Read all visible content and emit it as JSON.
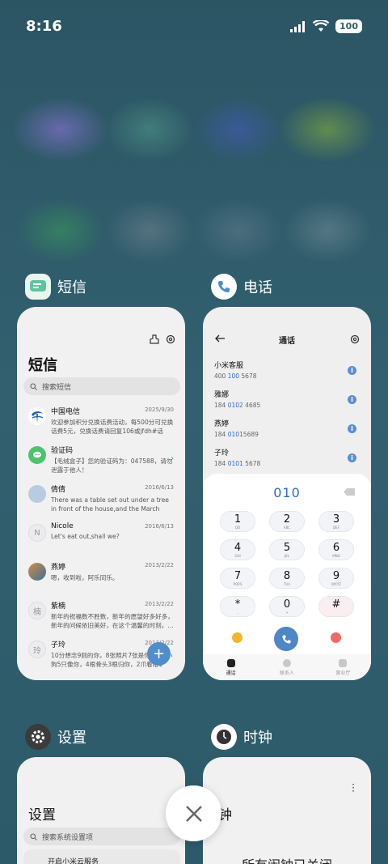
{
  "status": {
    "time": "8:16",
    "battery": "100"
  },
  "apps": {
    "sms": {
      "label": "短信",
      "title": "短信",
      "search_placeholder": "搜索短信",
      "messages": [
        {
          "name": "中国电信",
          "date": "2025/9/30",
          "preview": "欢迎参加积分兑换话费活动，每500分可兑换话费5元，兑换话费请回复106或jfdh#话费..."
        },
        {
          "name": "验证码",
          "date": "",
          "preview": "【毛绒盒子】您的验证码为：047588，请勿泄露于他人！"
        },
        {
          "name": "倩倩",
          "date": "2016/6/13",
          "preview": "There was a table set out under a tree in front of the house,and the March Hare an..."
        },
        {
          "name": "Nicole",
          "date": "2016/6/13",
          "preview": "Let's eat out,shall we?"
        },
        {
          "name": "燕婷",
          "date": "2013/2/22",
          "preview": "嗯，收到啦，阿乐同乐。"
        },
        {
          "name": "紫楠",
          "date": "2013/2/22",
          "preview": "新年的祝福数不胜数，新年的愿望好多好多，新年的问候依旧美好，在这个温馨的时刻，..."
        },
        {
          "name": "子玲",
          "date": "2013/2/22",
          "preview": "10分想念9则的你，8张照片7张是你，6只小狗5只像你，4根骨头3根归你，2爪看给1定..."
        }
      ],
      "avatar_letters": {
        "nicole": "N",
        "zinan": "楠",
        "ziling": "玲"
      }
    },
    "phone": {
      "label": "电话",
      "title": "通话",
      "contacts": [
        {
          "name": "小米客服",
          "num_pre": "400 ",
          "num_hl": "100",
          "num_post": " 5678"
        },
        {
          "name": "雅娜",
          "num_pre": "184 ",
          "num_hl": "0102",
          "num_post": " 4685"
        },
        {
          "name": "燕婷",
          "num_pre": "184 ",
          "num_hl": "010",
          "num_post": "15689"
        },
        {
          "name": "子玲",
          "num_pre": "184 ",
          "num_hl": "0101",
          "num_post": " 5678"
        }
      ],
      "dial_input": "010",
      "keys": [
        {
          "d": "1",
          "l": "QO"
        },
        {
          "d": "2",
          "l": "ABC"
        },
        {
          "d": "3",
          "l": "DEF"
        },
        {
          "d": "4",
          "l": "GHI"
        },
        {
          "d": "5",
          "l": "JKL"
        },
        {
          "d": "6",
          "l": "MNO"
        },
        {
          "d": "7",
          "l": "PQRS"
        },
        {
          "d": "8",
          "l": "TUV"
        },
        {
          "d": "9",
          "l": "WXYZ"
        },
        {
          "d": "*",
          "l": ","
        },
        {
          "d": "0",
          "l": "+"
        },
        {
          "d": "#",
          "l": ""
        }
      ],
      "tabs": [
        "通话",
        "联系人",
        "营业厅"
      ]
    },
    "settings": {
      "label": "设置",
      "title": "设置",
      "search_placeholder": "搜索系统设置项",
      "first_item": "开启小米云服务"
    },
    "clock": {
      "label": "时钟",
      "title": "闹钟",
      "empty_text": "所有闹钟已关闭"
    }
  },
  "colors": {
    "accent": "#4f8dcc",
    "background": "#2f5f6d"
  }
}
